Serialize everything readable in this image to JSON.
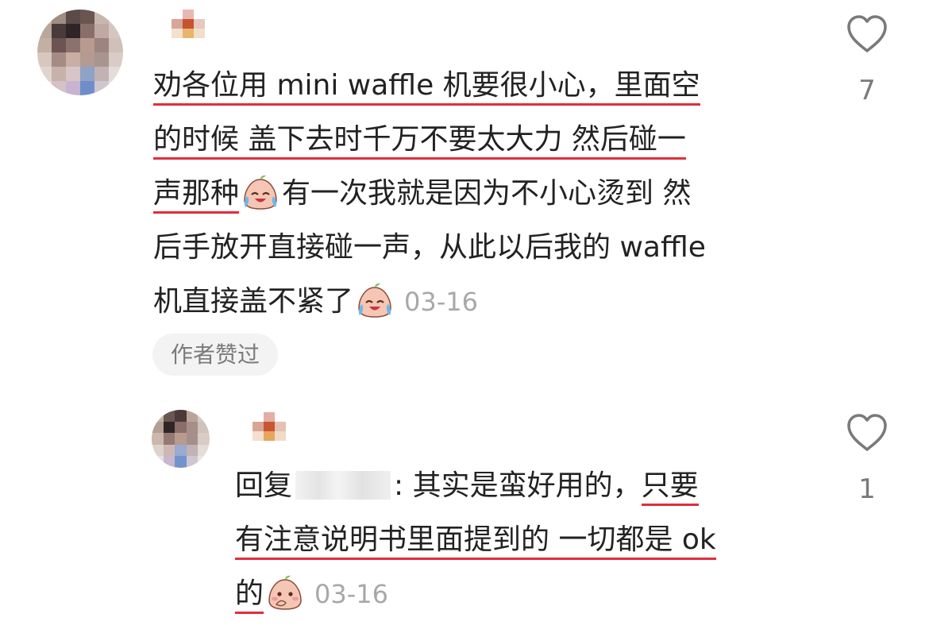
{
  "main_comment": {
    "lines": [
      "劝各位用 mini waffle 机要很小心，里面空",
      "的时候 盖下去时千万不要太大力 然后碰一",
      "声那种",
      "有一次我就是因为不小心烫到 然",
      "后手放开直接碰一声，从此以后我的 waffle",
      "机直接盖不紧了"
    ],
    "date": "03-16",
    "badge": "作者赞过",
    "like_count": "7",
    "emoji": "crying-laugh-emoji"
  },
  "reply_comment": {
    "prefix": "回复",
    "colon": ":",
    "lines": [
      " 其实是蛮好用的，",
      "只要",
      "有注意说明书里面提到的 一切都是 ok",
      "的"
    ],
    "date": "03-16",
    "like_count": "1",
    "emoji": "shy-emoji"
  },
  "colors": {
    "underline": "#e02e3d",
    "date_text": "#a8a8a8",
    "badge_bg": "#f3f3f3",
    "icon_gray": "#7a7a7a"
  }
}
